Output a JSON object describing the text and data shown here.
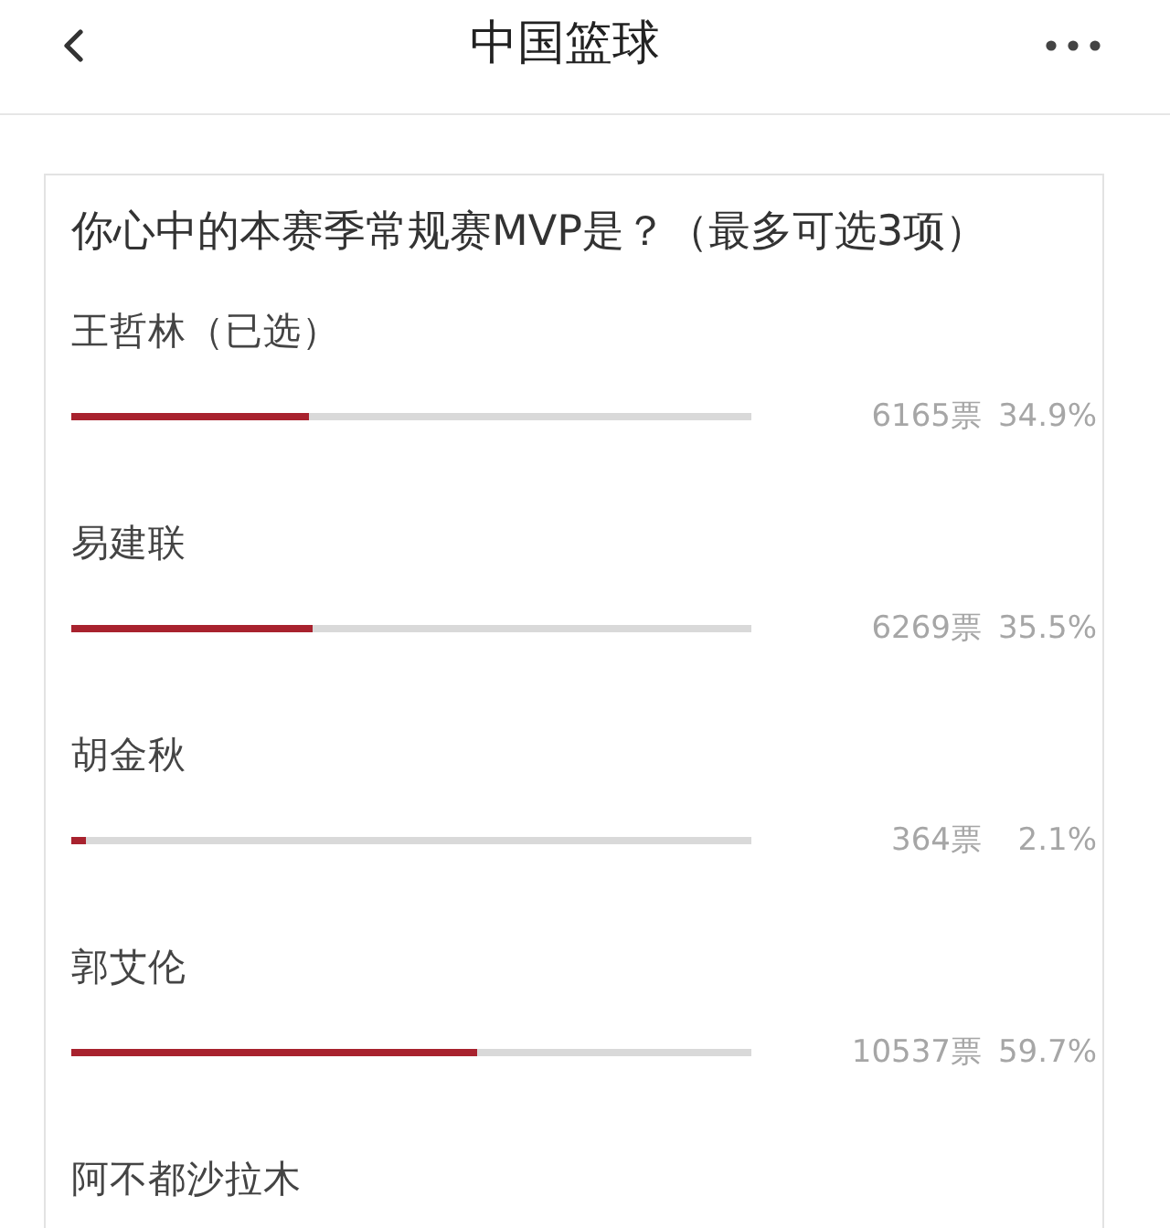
{
  "header": {
    "title": "中国篮球"
  },
  "poll": {
    "question": "你心中的本赛季常规赛MVP是？（最多可选3项）",
    "options": [
      {
        "name": "王哲林（已选）",
        "level": 0.349,
        "votes": "6165票",
        "percent": "34.9%"
      },
      {
        "name": "易建联",
        "level": 0.355,
        "votes": "6269票",
        "percent": "35.5%"
      },
      {
        "name": "胡金秋",
        "level": 0.021,
        "votes": "364票",
        "percent": "2.1%"
      },
      {
        "name": "郭艾伦",
        "level": 0.597,
        "votes": "10537票",
        "percent": "59.7%"
      },
      {
        "name": "阿不都沙拉木"
      }
    ]
  }
}
